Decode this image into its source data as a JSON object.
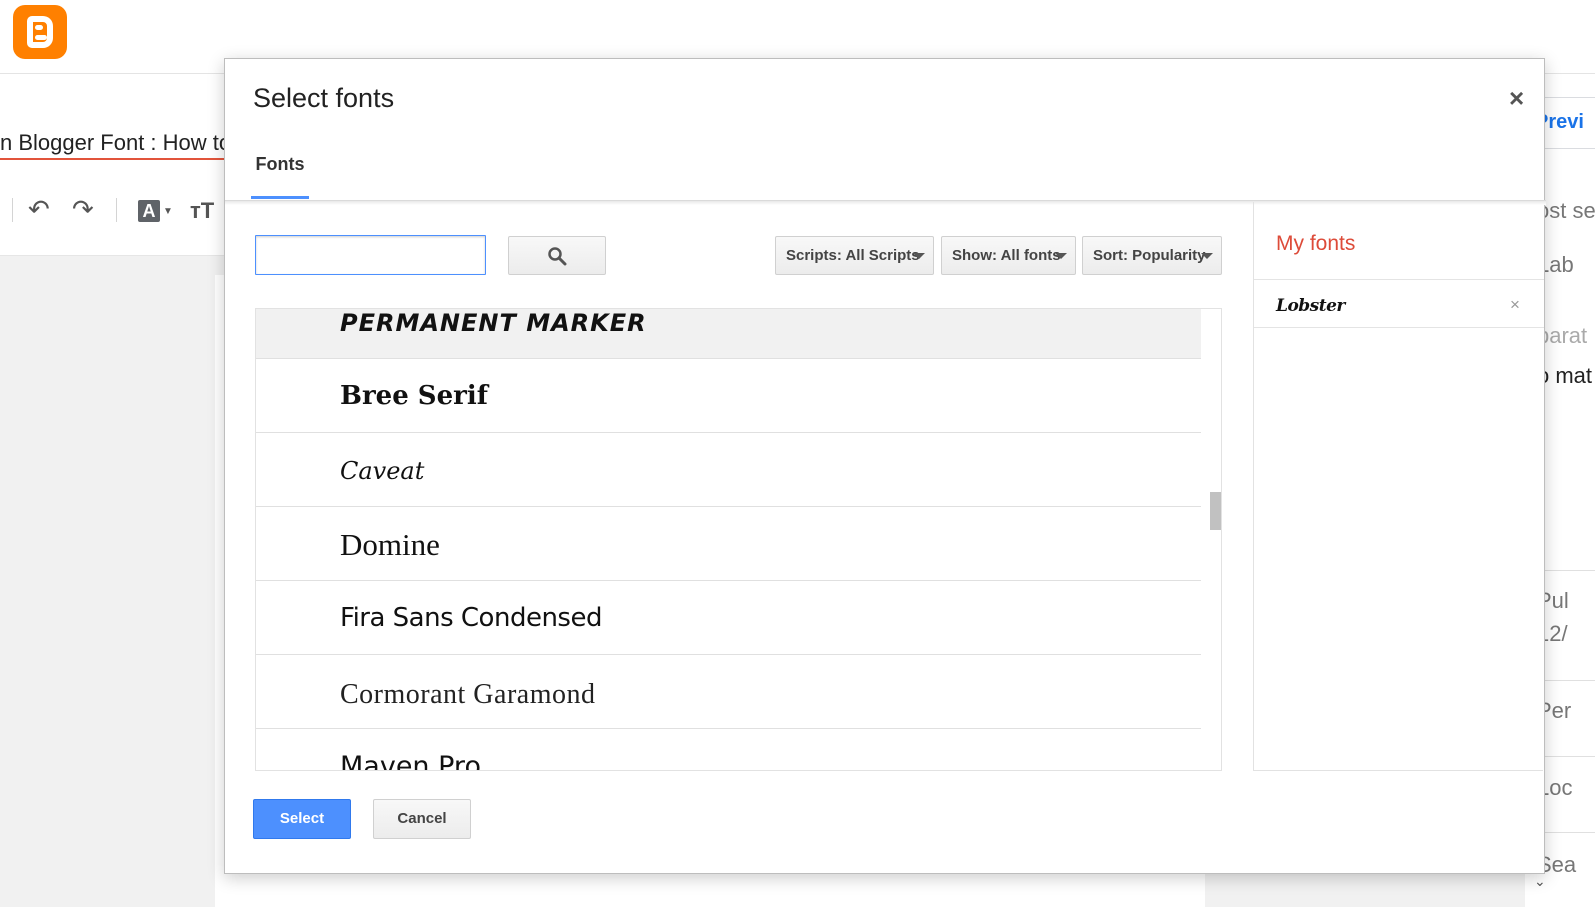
{
  "app": {
    "post_title": "n Blogger Font : How to",
    "preview_label": "Previ"
  },
  "right_panel": {
    "snippets": [
      "ost se",
      "Lab",
      "parat",
      "o mat",
      "Pul",
      "12/",
      "Per",
      "Loc",
      "Sea"
    ]
  },
  "dialog": {
    "title": "Select fonts",
    "close_glyph": "×",
    "tab_label": "Fonts",
    "search": {
      "value": "",
      "placeholder": ""
    },
    "filters": {
      "scripts": "Scripts: All Scripts",
      "show": "Show: All fonts",
      "sort": "Sort: Popularity"
    },
    "font_list": [
      {
        "name": "Permanent Marker",
        "selected": true
      },
      {
        "name": "Bree Serif",
        "selected": false
      },
      {
        "name": "Caveat",
        "selected": false
      },
      {
        "name": "Domine",
        "selected": false
      },
      {
        "name": "Fira Sans Condensed",
        "selected": false
      },
      {
        "name": "Cormorant Garamond",
        "selected": false
      },
      {
        "name": "Maven Pro",
        "selected": false
      }
    ],
    "my_fonts": {
      "title": "My fonts",
      "items": [
        {
          "name": "Lobster",
          "remove_glyph": "×"
        }
      ]
    },
    "buttons": {
      "select": "Select",
      "cancel": "Cancel"
    }
  },
  "colors": {
    "accent_blue": "#4d90fe",
    "my_fonts_red": "#dd4b39",
    "blogger_orange": "#ff8000"
  }
}
